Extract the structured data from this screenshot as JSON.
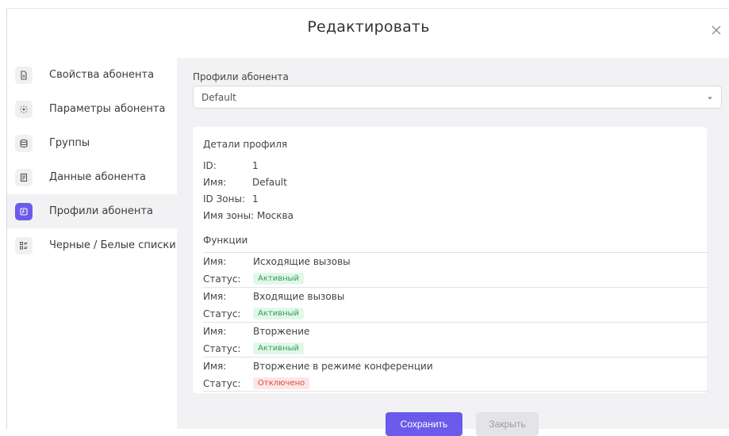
{
  "dialog": {
    "title": "Редактировать"
  },
  "sidebar": {
    "items": [
      {
        "label": "Свойства абонента",
        "icon": "document-icon",
        "active": false
      },
      {
        "label": "Параметры абонента",
        "icon": "settings-dots-icon",
        "active": false
      },
      {
        "label": "Группы",
        "icon": "database-icon",
        "active": false
      },
      {
        "label": "Данные абонента",
        "icon": "clipboard-icon",
        "active": false
      },
      {
        "label": "Профили абонента",
        "icon": "profile-card-icon",
        "active": true
      },
      {
        "label": "Черные / Белые списки",
        "icon": "list-icon",
        "active": false
      }
    ]
  },
  "profile": {
    "select_label": "Профили абонента",
    "selected_value": "Default"
  },
  "details": {
    "title": "Детали профиля",
    "rows": [
      {
        "key": "ID:",
        "value": "1"
      },
      {
        "key": "Имя:",
        "value": "Default"
      },
      {
        "key": "ID Зоны:",
        "value": "1"
      },
      {
        "key": "Имя зоны:",
        "value": "Москва"
      }
    ]
  },
  "functions": {
    "title": "Функции",
    "name_key": "Имя:",
    "status_key": "Статус:",
    "items": [
      {
        "name": "Исходящие вызовы",
        "status": "Активный",
        "status_type": "active"
      },
      {
        "name": "Входящие вызовы",
        "status": "Активный",
        "status_type": "active"
      },
      {
        "name": "Вторжение",
        "status": "Активный",
        "status_type": "active"
      },
      {
        "name": "Вторжение в режиме конференции",
        "status": "Отключено",
        "status_type": "disabled"
      }
    ]
  },
  "buttons": {
    "save": "Сохранить",
    "close": "Закрыть"
  },
  "colors": {
    "accent": "#6b5bea",
    "active_badge_bg": "#e3f7e9",
    "active_badge_text": "#2f9e55",
    "disabled_badge_bg": "#fde6e6",
    "disabled_badge_text": "#d84848"
  }
}
